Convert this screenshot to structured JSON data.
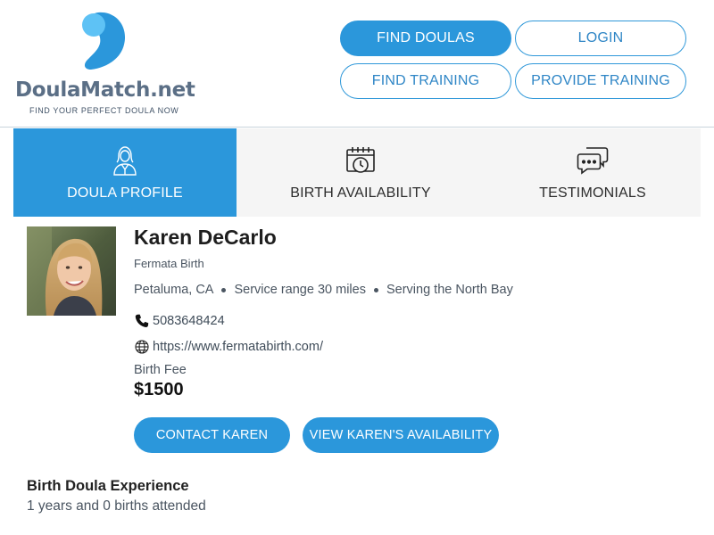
{
  "brand": {
    "name_main": "DoulaMatch",
    "name_suffix": ".net",
    "tagline": "FIND YOUR PERFECT DOULA NOW",
    "colors": {
      "primary": "#2b97db",
      "logo_light": "#5ec2f5",
      "logo_text": "#5b6f86"
    }
  },
  "nav": {
    "find_doulas": "FIND DOULAS",
    "login": "LOGIN",
    "find_training": "FIND TRAINING",
    "provide_training": "PROVIDE TRAINING"
  },
  "tabs": [
    {
      "label": "DOULA PROFILE",
      "icon": "doula-person-icon",
      "active": true
    },
    {
      "label": "BIRTH AVAILABILITY",
      "icon": "calendar-clock-icon",
      "active": false
    },
    {
      "label": "TESTIMONIALS",
      "icon": "chat-bubbles-icon",
      "active": false
    }
  ],
  "profile": {
    "name": "Karen DeCarlo",
    "organization": "Fermata Birth",
    "location": "Petaluma, CA",
    "service_range": "Service range 30 miles",
    "serving": "Serving the North Bay",
    "phone": "5083648424",
    "website": "https://www.fermatabirth.com/",
    "fee_label": "Birth Fee",
    "fee_value": "$1500",
    "contact_button": "CONTACT KAREN",
    "availability_button": "VIEW KAREN'S AVAILABILITY"
  },
  "experience": {
    "title": "Birth Doula Experience",
    "value": "1 years and 0 births attended"
  }
}
